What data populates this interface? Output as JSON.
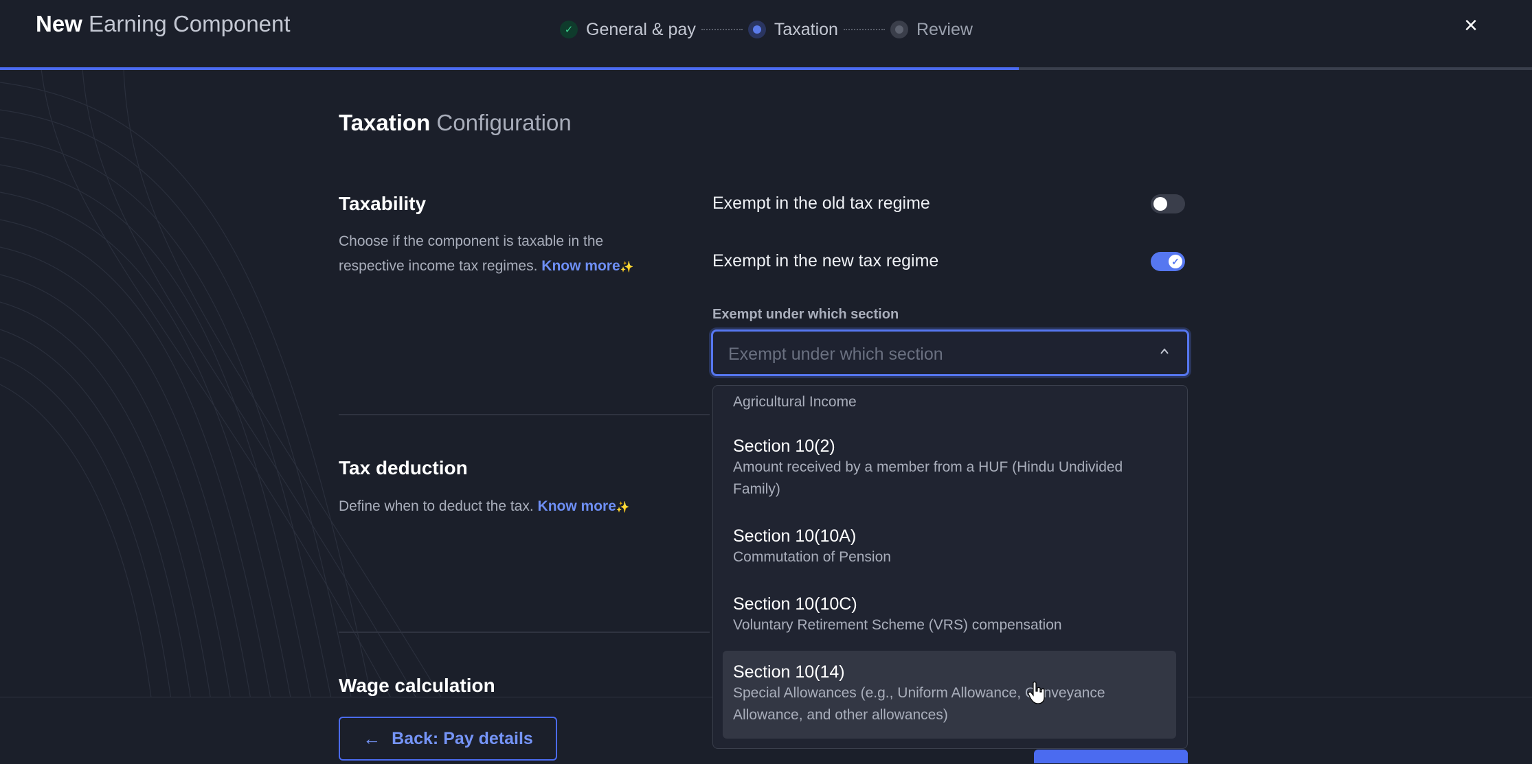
{
  "header": {
    "title_strong": "New",
    "title_light": "Earning Component",
    "close_glyph": "×"
  },
  "stepper": {
    "steps": [
      {
        "label": "General & pay",
        "state": "done"
      },
      {
        "label": "Taxation",
        "state": "current"
      },
      {
        "label": "Review",
        "state": "todo"
      }
    ],
    "check_glyph": "✓"
  },
  "progress": {
    "fraction": 0.665,
    "color": "#4b6bf0"
  },
  "page": {
    "title_strong": "Taxation",
    "title_light": "Configuration"
  },
  "taxability": {
    "heading": "Taxability",
    "desc_line1": "Choose if the component is taxable in the",
    "desc_line2": "respective income tax regimes.",
    "know_more": "Know more",
    "sparkle": "✨",
    "old_regime_label": "Exempt in the old tax regime",
    "old_regime_on": false,
    "new_regime_label": "Exempt in the new tax regime",
    "new_regime_on": true,
    "toggle_check": "✓",
    "section_field_label": "Exempt under which section",
    "section_placeholder": "Exempt under which section"
  },
  "dropdown": {
    "partial_item_desc": "Agricultural Income",
    "options": [
      {
        "title": "Section 10(2)",
        "desc": "Amount received by a member from a HUF (Hindu Undivided Family)"
      },
      {
        "title": "Section 10(10A)",
        "desc": "Commutation of Pension"
      },
      {
        "title": "Section 10(10C)",
        "desc": "Voluntary Retirement Scheme (VRS) compensation"
      },
      {
        "title": "Section 10(14)",
        "desc": "Special Allowances (e.g., Uniform Allowance, Conveyance Allowance, and other allowances)",
        "hovered": true
      }
    ]
  },
  "tax_deduction": {
    "heading": "Tax deduction",
    "desc": "Define when to deduct the tax.",
    "know_more": "Know more",
    "sparkle": "✨"
  },
  "wage_calculation": {
    "heading": "Wage calculation"
  },
  "footer": {
    "back_label": "Back: Pay details",
    "back_arrow": "←"
  },
  "colors": {
    "accent": "#4b6bf0",
    "background": "#1b1f2a",
    "success": "#3ccf8e"
  }
}
